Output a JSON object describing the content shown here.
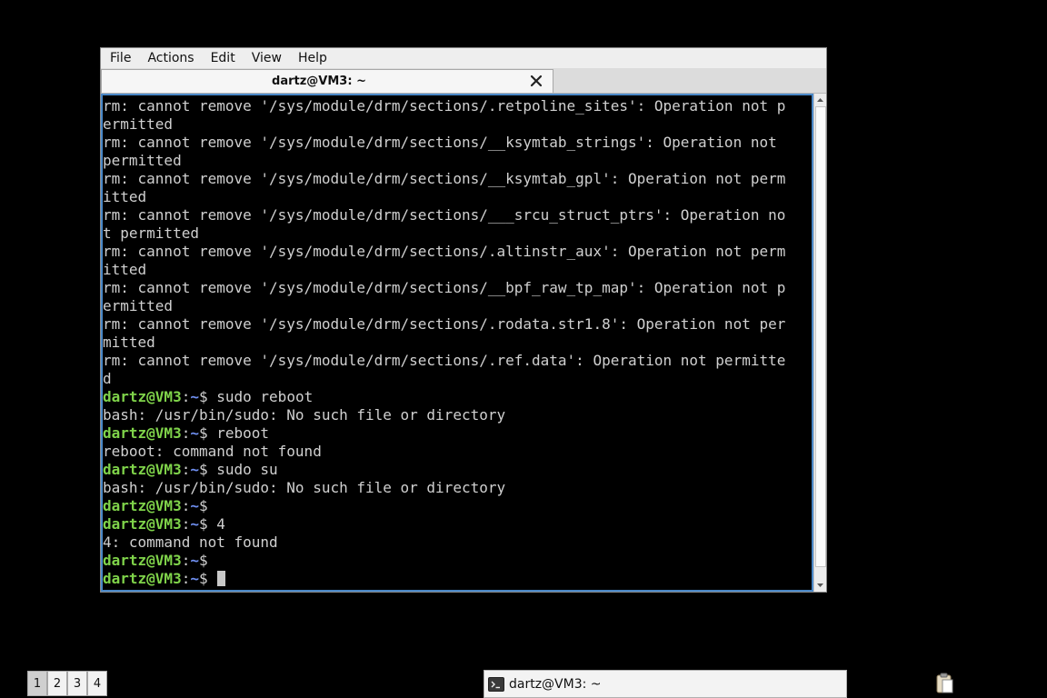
{
  "window": {
    "menu": [
      "File",
      "Actions",
      "Edit",
      "View",
      "Help"
    ],
    "tab_title": "dartz@VM3: ~"
  },
  "terminal": {
    "lines": [
      {
        "type": "out",
        "text": "rm: cannot remove '/sys/module/drm/sections/.retpoline_sites': Operation not p"
      },
      {
        "type": "out",
        "text": "ermitted"
      },
      {
        "type": "out",
        "text": "rm: cannot remove '/sys/module/drm/sections/__ksymtab_strings': Operation not"
      },
      {
        "type": "out",
        "text": "permitted"
      },
      {
        "type": "out",
        "text": "rm: cannot remove '/sys/module/drm/sections/__ksymtab_gpl': Operation not perm"
      },
      {
        "type": "out",
        "text": "itted"
      },
      {
        "type": "out",
        "text": "rm: cannot remove '/sys/module/drm/sections/___srcu_struct_ptrs': Operation no"
      },
      {
        "type": "out",
        "text": "t permitted"
      },
      {
        "type": "out",
        "text": "rm: cannot remove '/sys/module/drm/sections/.altinstr_aux': Operation not perm"
      },
      {
        "type": "out",
        "text": "itted"
      },
      {
        "type": "out",
        "text": "rm: cannot remove '/sys/module/drm/sections/__bpf_raw_tp_map': Operation not p"
      },
      {
        "type": "out",
        "text": "ermitted"
      },
      {
        "type": "out",
        "text": "rm: cannot remove '/sys/module/drm/sections/.rodata.str1.8': Operation not per"
      },
      {
        "type": "out",
        "text": "mitted"
      },
      {
        "type": "out",
        "text": "rm: cannot remove '/sys/module/drm/sections/.ref.data': Operation not permitte"
      },
      {
        "type": "out",
        "text": "d"
      },
      {
        "type": "prompt",
        "user": "dartz@VM3",
        "path": "~",
        "cmd": "sudo reboot"
      },
      {
        "type": "out",
        "text": "bash: /usr/bin/sudo: No such file or directory"
      },
      {
        "type": "prompt",
        "user": "dartz@VM3",
        "path": "~",
        "cmd": "reboot"
      },
      {
        "type": "out",
        "text": "reboot: command not found"
      },
      {
        "type": "prompt",
        "user": "dartz@VM3",
        "path": "~",
        "cmd": "sudo su"
      },
      {
        "type": "out",
        "text": "bash: /usr/bin/sudo: No such file or directory"
      },
      {
        "type": "prompt",
        "user": "dartz@VM3",
        "path": "~",
        "cmd": ""
      },
      {
        "type": "prompt",
        "user": "dartz@VM3",
        "path": "~",
        "cmd": "4"
      },
      {
        "type": "out",
        "text": "4: command not found"
      },
      {
        "type": "prompt",
        "user": "dartz@VM3",
        "path": "~",
        "cmd": ""
      },
      {
        "type": "prompt",
        "user": "dartz@VM3",
        "path": "~",
        "cmd": "",
        "cursor": true
      }
    ],
    "colors": {
      "user": "#7fd34a",
      "path": "#6f8ff0",
      "text": "#d0d0d0",
      "background": "#000000"
    }
  },
  "taskbar": {
    "workspaces": [
      "1",
      "2",
      "3",
      "4"
    ],
    "active_workspace": "1",
    "task_label": "dartz@VM3: ~",
    "task_icon": "terminal-icon",
    "tray_icon": "clipboard-icon"
  }
}
